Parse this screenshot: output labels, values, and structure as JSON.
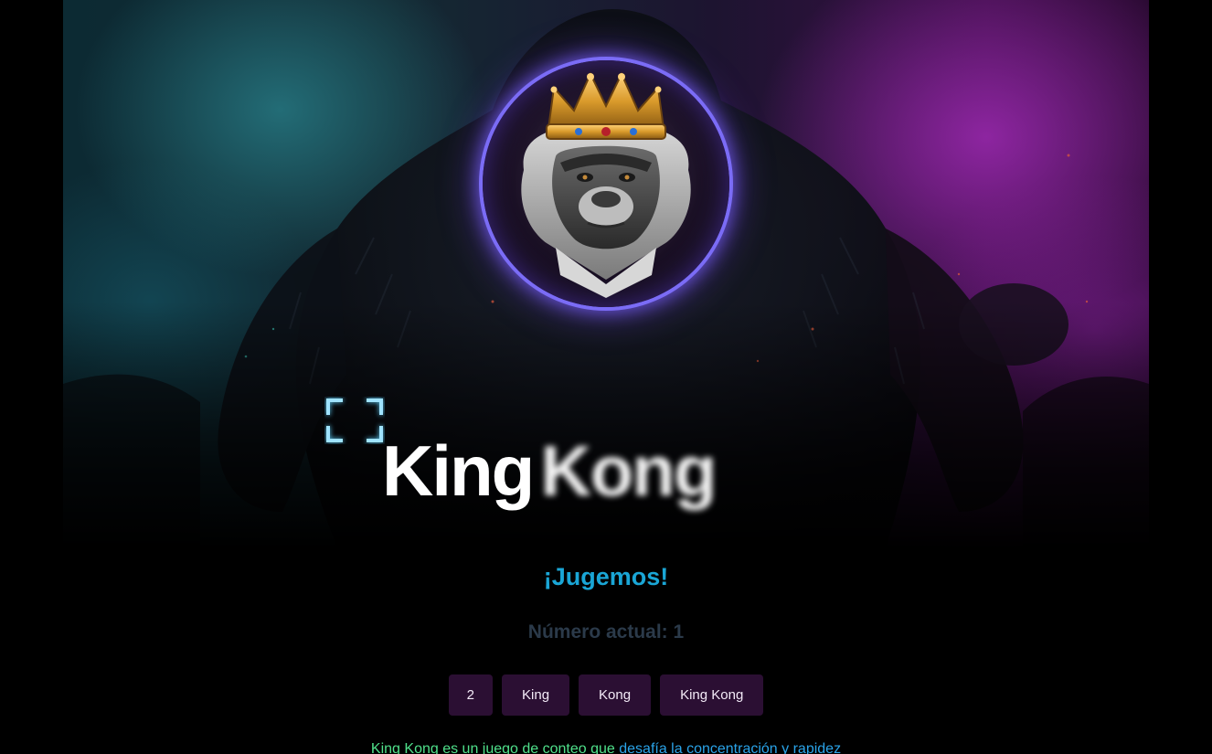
{
  "title": {
    "word1": "King",
    "word2": "Kong"
  },
  "subtitle": "¡Jugemos!",
  "counter": {
    "label": "Número actual:",
    "value": "1"
  },
  "buttons": [
    {
      "label": "2"
    },
    {
      "label": "King"
    },
    {
      "label": "Kong"
    },
    {
      "label": "King Kong"
    }
  ],
  "description": {
    "part1": "King Kong es un juego de conteo que ",
    "part2": "desafía la concentración y rapidez"
  },
  "colors": {
    "accent": "#1aa6d6",
    "button_bg": "#2b0f33",
    "ring": "#7b6cf6"
  },
  "icons": {
    "focus": "focus-frame-icon",
    "avatar": "crowned-gorilla-logo"
  }
}
